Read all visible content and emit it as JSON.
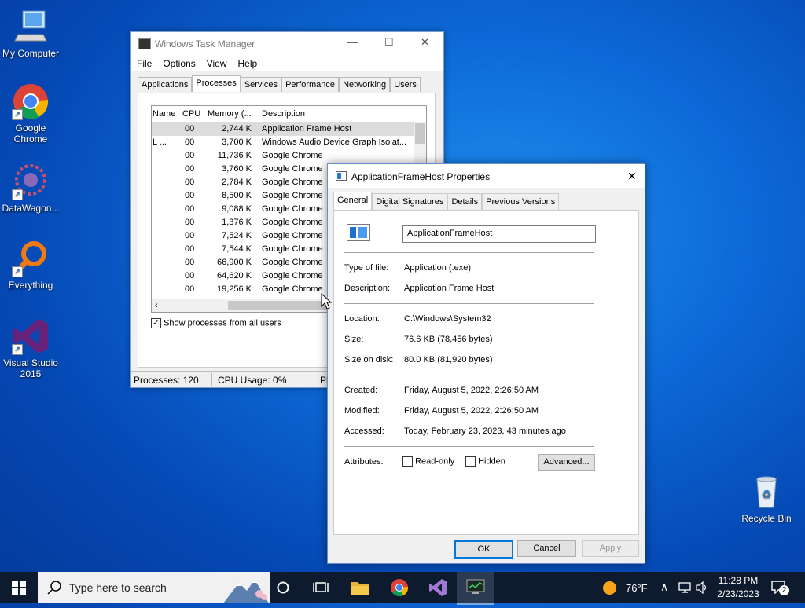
{
  "desktop": {
    "icons": [
      {
        "label": "My Computer",
        "icon": "computer-icon"
      },
      {
        "label": "Google Chrome",
        "icon": "chrome-icon"
      },
      {
        "label": "DataWagon...",
        "icon": "datawagon-icon"
      },
      {
        "label": "Everything",
        "icon": "everything-search-icon"
      },
      {
        "label": "Visual Studio 2015",
        "icon": "visual-studio-icon"
      },
      {
        "label": "Recycle Bin",
        "icon": "recycle-bin-icon"
      }
    ]
  },
  "task_manager": {
    "title": "Windows Task Manager",
    "menu": [
      "File",
      "Options",
      "View",
      "Help"
    ],
    "tabs": [
      "Applications",
      "Processes",
      "Services",
      "Performance",
      "Networking",
      "Users"
    ],
    "active_tab": "Processes",
    "columns": [
      "Name",
      "CPU",
      "Memory (...",
      "Description"
    ],
    "rows": [
      {
        "name": "",
        "cpu": "00",
        "memory": "2,744 K",
        "description": "Application Frame Host"
      },
      {
        "name": "L ...",
        "cpu": "00",
        "memory": "3,700 K",
        "description": "Windows Audio Device Graph Isolat..."
      },
      {
        "name": "",
        "cpu": "00",
        "memory": "11,736 K",
        "description": "Google Chrome"
      },
      {
        "name": "",
        "cpu": "00",
        "memory": "3,760 K",
        "description": "Google Chrome"
      },
      {
        "name": "",
        "cpu": "00",
        "memory": "2,784 K",
        "description": "Google Chrome"
      },
      {
        "name": "",
        "cpu": "00",
        "memory": "8,500 K",
        "description": "Google Chrome"
      },
      {
        "name": "",
        "cpu": "00",
        "memory": "9,088 K",
        "description": "Google Chrome"
      },
      {
        "name": "",
        "cpu": "00",
        "memory": "1,376 K",
        "description": "Google Chrome"
      },
      {
        "name": "",
        "cpu": "00",
        "memory": "7,524 K",
        "description": "Google Chrome"
      },
      {
        "name": "",
        "cpu": "00",
        "memory": "7,544 K",
        "description": "Google Chrome"
      },
      {
        "name": "",
        "cpu": "00",
        "memory": "66,900 K",
        "description": "Google Chrome"
      },
      {
        "name": "",
        "cpu": "00",
        "memory": "64,620 K",
        "description": "Google Chrome"
      },
      {
        "name": "",
        "cpu": "00",
        "memory": "19,256 K",
        "description": "Google Chrome"
      },
      {
        "name": "EM",
        "cpu": "00",
        "memory": "568 K",
        "description": "Client Server Ru..."
      }
    ],
    "show_all_label": "Show processes from all users",
    "status_processes": "Processes: 120",
    "status_cpu": "CPU Usage: 0%",
    "status_extra": "Pl"
  },
  "properties": {
    "title": "ApplicationFrameHost Properties",
    "tabs": [
      "General",
      "Digital Signatures",
      "Details",
      "Previous Versions"
    ],
    "name_value": "ApplicationFrameHost",
    "fields": {
      "type_label": "Type of file:",
      "type_value": "Application (.exe)",
      "desc_label": "Description:",
      "desc_value": "Application Frame Host",
      "location_label": "Location:",
      "location_value": "C:\\Windows\\System32",
      "size_label": "Size:",
      "size_value": "76.6 KB (78,456 bytes)",
      "disk_label": "Size on disk:",
      "disk_value": "80.0 KB (81,920 bytes)",
      "created_label": "Created:",
      "created_value": "Friday, August 5, 2022, 2:26:50 AM",
      "modified_label": "Modified:",
      "modified_value": "Friday, August 5, 2022, 2:26:50 AM",
      "accessed_label": "Accessed:",
      "accessed_value": "Today, February 23, 2023, 43 minutes ago",
      "attributes_label": "Attributes:"
    },
    "readonly_label": "Read-only",
    "hidden_label": "Hidden",
    "advanced_label": "Advanced...",
    "ok_label": "OK",
    "cancel_label": "Cancel",
    "apply_label": "Apply"
  },
  "taskbar": {
    "search_placeholder": "Type here to search",
    "weather": "76°F",
    "time": "11:28 PM",
    "date": "2/23/2023",
    "notification_count": "2"
  }
}
